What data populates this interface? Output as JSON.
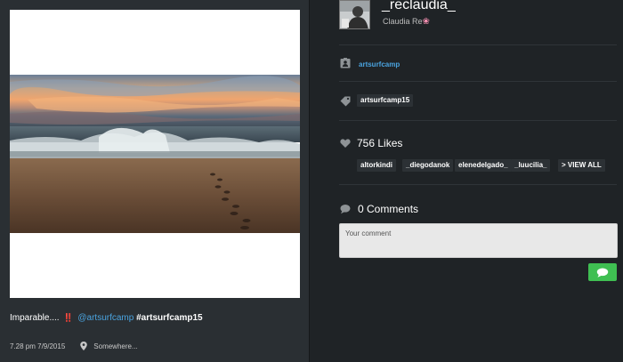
{
  "post": {
    "caption_text": "Imparable....",
    "caption_emoji": "‼️",
    "caption_mention": "@artsurfcamp",
    "caption_hashtag": "#artsurfcamp15",
    "datetime": "7.28 pm 7/9/2015",
    "location": "Somewhere...",
    "photo_icon": "beach-sunset-photo"
  },
  "author": {
    "username": "_reclaudia_",
    "full_name": "Claudia Re",
    "name_emoji": "❀",
    "avatar_icon": "user-avatar"
  },
  "tagged_user": {
    "icon": "person-badge-icon",
    "name": "artsurfcamp"
  },
  "tags": {
    "icon": "tag-icon",
    "items": [
      "artsurfcamp15"
    ]
  },
  "likes": {
    "icon": "heart-icon",
    "label": "756 Likes",
    "users": [
      "altorkindi",
      "_diegodanok",
      "elenedelgado_",
      "_luucilia_"
    ],
    "view_all": "> VIEW ALL"
  },
  "comments": {
    "icon": "speech-bubble-icon",
    "label": "0 Comments",
    "placeholder": "Your comment",
    "send_icon": "chat-send-icon"
  },
  "colors": {
    "background": "#1f2326",
    "panel": "#2a2f33",
    "link": "#4aa3df",
    "send_button": "#3fbf52",
    "chip": "#2c3135"
  }
}
